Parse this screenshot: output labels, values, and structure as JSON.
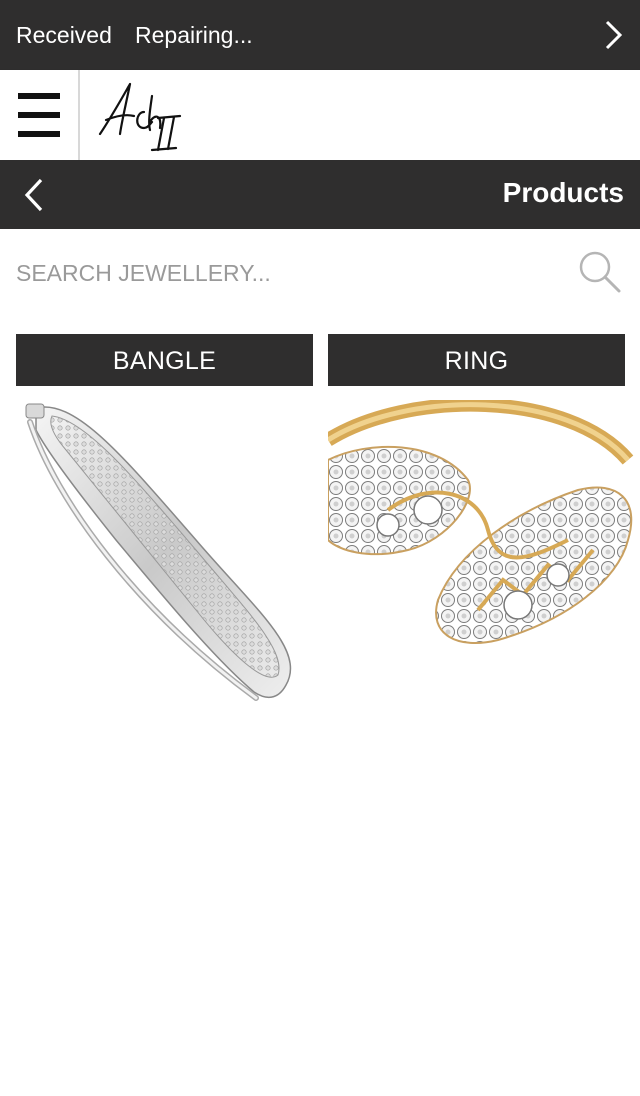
{
  "status_tabs": {
    "items": [
      {
        "label": "Received"
      },
      {
        "label": "Repairing..."
      }
    ],
    "next_icon": "chevron-right-icon"
  },
  "header": {
    "menu_icon": "hamburger-menu-icon",
    "logo_text": "Ach II"
  },
  "title_bar": {
    "back_icon": "chevron-left-icon",
    "title": "Products"
  },
  "search": {
    "placeholder": "SEARCH JEWELLERY...",
    "value": "",
    "icon": "search-icon"
  },
  "categories": [
    {
      "label": "BANGLE",
      "image": "bangle-image"
    },
    {
      "label": "RING",
      "image": "ring-image"
    }
  ],
  "colors": {
    "bar_background": "#2f2e2e",
    "text_light": "#ffffff",
    "placeholder": "#9a9a9a",
    "ring_gold": "#d7a955"
  }
}
